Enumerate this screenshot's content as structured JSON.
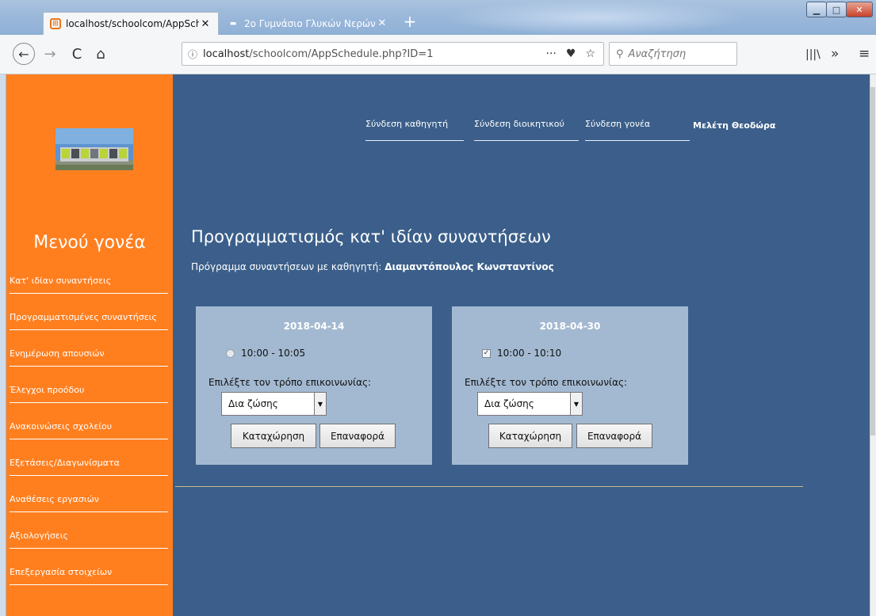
{
  "browser": {
    "tabs": [
      {
        "title": "localhost/schoolcom/AppSche",
        "active": true
      },
      {
        "title": "2ο Γυμνάσιο Γλυκών Νερών -",
        "active": false
      }
    ],
    "new_tab": "+",
    "url_host": "localhost",
    "url_path": "/schoolcom/AppSchedule.php?ID=1",
    "search_placeholder": "Αναζήτηση",
    "icons": {
      "back": "←",
      "forward": "→",
      "reload": "C",
      "home": "⌂",
      "info": "ⓘ",
      "more": "···",
      "pocket": "♥",
      "star": "☆",
      "search": "⚲",
      "library": "|||\\",
      "overflow": "»",
      "menu": "≡",
      "close": "✕",
      "min": "▁",
      "max": "□"
    }
  },
  "sidebar": {
    "title": "Μενού γονέα",
    "items": [
      "Κατ' ιδίαν συναντήσεις",
      "Προγραμματισμένες συναντήσεις",
      "Ενημέρωση απουσιών",
      "Έλεγχοι προόδου",
      "Ανακοινώσεις σχολείου",
      "Εξετάσεις/Διαγωνίσματα",
      "Αναθέσεις εργασιών",
      "Αξιολογήσεις",
      "Επεξεργασία στοιχείων"
    ]
  },
  "topnav": {
    "teacher_login": "Σύνδεση καθηγητή",
    "admin_login": "Σύνδεση διοικητικού",
    "parent_login": "Σύνδεση γονέα",
    "user_name": "Μελέτη Θεοδώρα"
  },
  "main": {
    "title": "Προγραμματισμός κατ' ιδίαν συναντήσεων",
    "subtitle_prefix": "Πρόγραμμα συναντήσεων με καθηγητή: ",
    "teacher_name": "Διαμαντόπουλος Κωνσταντίνος",
    "cards": [
      {
        "date": "2018-04-14",
        "slot": "10:00 - 10:05",
        "slot_control": "radio",
        "checked": false,
        "comm_label": "Επιλέξτε τον τρόπο επικοινωνίας:",
        "comm_value": "Δια ζώσης",
        "submit": "Καταχώρηση",
        "reset": "Επαναφορά"
      },
      {
        "date": "2018-04-30",
        "slot": "10:00 - 10:10",
        "slot_control": "checkbox",
        "checked": true,
        "comm_label": "Επιλέξτε τον τρόπο επικοινωνίας:",
        "comm_value": "Δια ζώσης",
        "submit": "Καταχώρηση",
        "reset": "Επαναφορά"
      }
    ]
  },
  "colors": {
    "page_bg": "#3b5f8a",
    "sidebar_bg": "#ff7f1f",
    "card_bg": "#a3b9d1"
  }
}
